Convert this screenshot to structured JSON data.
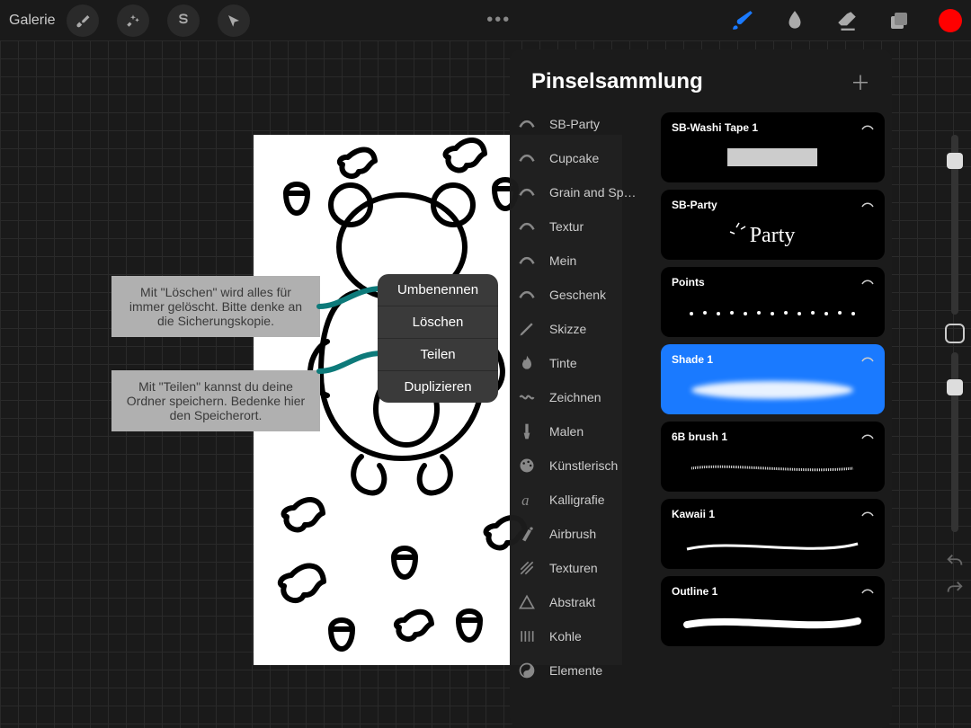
{
  "toolbar": {
    "gallery": "Galerie",
    "brush_active": true,
    "color": "#ff0000"
  },
  "context_menu": {
    "items": [
      "Umbenennen",
      "Löschen",
      "Teilen",
      "Duplizieren"
    ]
  },
  "annotations": {
    "delete_hint": "Mit \"Löschen\" wird alles für immer gelöscht. Bitte denke an die Sicherungskopie.",
    "share_hint": "Mit \"Teilen\" kannst du deine Ordner speichern. Bedenke hier den Speicherort."
  },
  "brush_panel": {
    "title": "Pinselsammlung",
    "sets": [
      {
        "label": "SB-Party",
        "icon": "stroke"
      },
      {
        "label": "Cupcake",
        "icon": "stroke"
      },
      {
        "label": "Grain and Speckle by...",
        "icon": "stroke"
      },
      {
        "label": "Textur",
        "icon": "stroke"
      },
      {
        "label": "Mein",
        "icon": "stroke"
      },
      {
        "label": "Geschenk",
        "icon": "stroke"
      },
      {
        "label": "Skizze",
        "icon": "pencil"
      },
      {
        "label": "Tinte",
        "icon": "flame"
      },
      {
        "label": "Zeichnen",
        "icon": "squiggle"
      },
      {
        "label": "Malen",
        "icon": "paintbrush"
      },
      {
        "label": "Künstlerisch",
        "icon": "palette"
      },
      {
        "label": "Kalligrafie",
        "icon": "letter-a"
      },
      {
        "label": "Airbrush",
        "icon": "airbrush"
      },
      {
        "label": "Texturen",
        "icon": "hatch"
      },
      {
        "label": "Abstrakt",
        "icon": "triangle"
      },
      {
        "label": "Kohle",
        "icon": "lines"
      },
      {
        "label": "Elemente",
        "icon": "yinyang"
      }
    ],
    "brushes": [
      {
        "name": "SB-Washi Tape 1",
        "selected": false,
        "preview": "tape"
      },
      {
        "name": "SB-Party",
        "selected": false,
        "preview": "party"
      },
      {
        "name": "Points",
        "selected": false,
        "preview": "dots"
      },
      {
        "name": "Shade 1",
        "selected": true,
        "preview": "shade"
      },
      {
        "name": "6B brush 1",
        "selected": false,
        "preview": "pencil"
      },
      {
        "name": "Kawaii 1",
        "selected": false,
        "preview": "thin"
      },
      {
        "name": "Outline 1",
        "selected": false,
        "preview": "outline"
      }
    ]
  }
}
